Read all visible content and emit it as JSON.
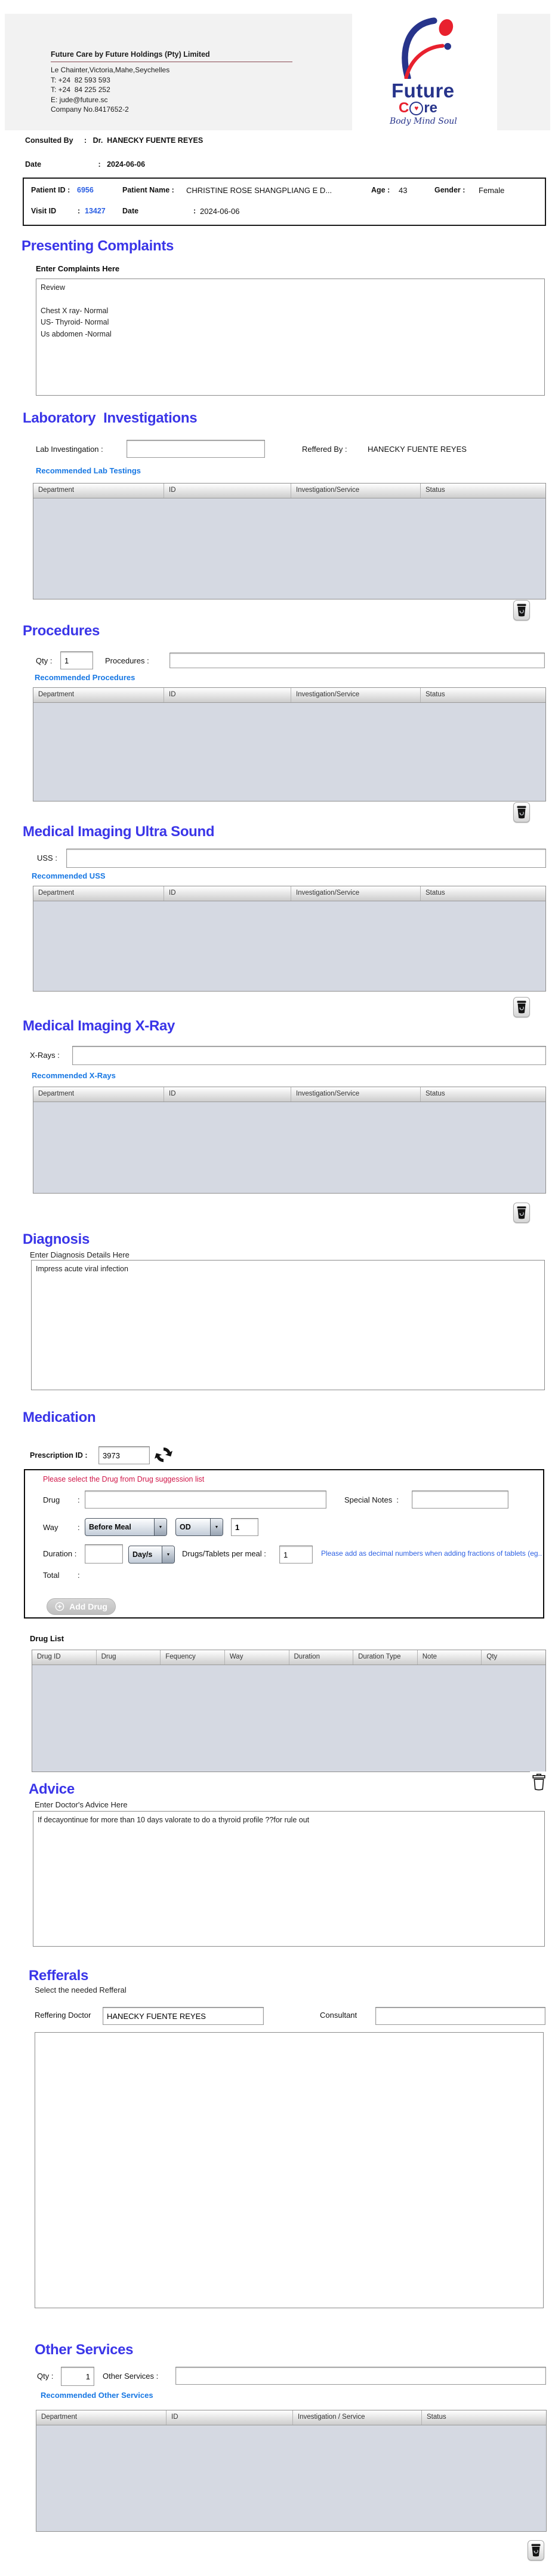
{
  "colors": {
    "section_heading": "#3a35e8",
    "link_blue": "#1777e3",
    "value_blue": "#2b5fe3",
    "note_red": "#d01648",
    "logo_navy": "#27348b",
    "logo_red": "#e8212e",
    "table_body": "#d5d9e2"
  },
  "icons": {
    "delete": "trash-icon",
    "delete_outline": "trash-outline-icon",
    "refresh": "refresh-icon",
    "add": "plus-circle-icon",
    "dropdown": "chevron-down-icon",
    "heart": "heart-icon"
  },
  "company": {
    "name": "Future Care by Future Holdings (Pty) Limited",
    "address": "Le Chainter,Victoria,Mahe,Seychelles",
    "tel1": "T: +24  82 593 593",
    "tel2": "T: +24  84 225 252",
    "email": "E: jude@future.sc",
    "company_no": "Company No.8417652-2"
  },
  "logo": {
    "future": "Future",
    "care_c": "C",
    "care_re": "re",
    "heart": "♥",
    "tagline": "Body Mind Soul"
  },
  "consult": {
    "label": "Consulted By",
    "colon": ":",
    "value": "Dr.  HANECKY FUENTE REYES",
    "date_label": "Date",
    "date_colon": ":",
    "date_value": "2024-06-06"
  },
  "patient": {
    "id_label": "Patient ID :",
    "id": "6956",
    "name_label": "Patient Name :",
    "name": "CHRISTINE ROSE SHANGPLIANG E D...",
    "age_label": "Age :",
    "age": "43",
    "gender_label": "Gender :",
    "gender": "Female",
    "visit_label": "Visit ID",
    "visit_colon": ":",
    "visit": "13427",
    "date_label": "Date",
    "date_colon": ":",
    "date": "2024-06-06"
  },
  "complaints": {
    "heading": "Presenting Complaints",
    "sub": "Enter Complaints Here",
    "text": "Review\n\nChest X ray- Normal\nUS- Thyroid- Normal\nUs abdomen -Normal"
  },
  "svc_headers": [
    "Department",
    "ID",
    "Investigation/Service",
    "Status"
  ],
  "lab": {
    "heading": "Laboratory  Investigations",
    "label": "Lab Investingation :",
    "value": "",
    "ref_label": "Reffered By :",
    "ref_value": "HANECKY FUENTE REYES",
    "link": "Recommended Lab Testings"
  },
  "procedures": {
    "heading": "Procedures",
    "qty_label": "Qty :",
    "qty": "1",
    "label": "Procedures :",
    "value": "",
    "link": "Recommended Procedures"
  },
  "uss": {
    "heading": "Medical Imaging Ultra Sound",
    "label": "USS :",
    "value": "",
    "link": "Recommended USS"
  },
  "xray": {
    "heading": "Medical Imaging X-Ray",
    "label": "X-Rays :",
    "value": "",
    "link": "Recommended X-Rays"
  },
  "diagnosis": {
    "heading": "Diagnosis",
    "sub": "Enter Diagnosis Details Here",
    "text": "Impress acute viral infection"
  },
  "medication": {
    "heading": "Medication",
    "prescription_label": "Prescription ID :",
    "prescription_id": "3973",
    "note_red": "Please select the Drug from Drug suggession list",
    "drug_label": "Drug",
    "colon": ":",
    "special_label": "Special Notes  :",
    "way_label": "Way",
    "way_meal": "Before Meal",
    "way_freq": "OD",
    "way_qty": "1",
    "duration_label": "Duration :",
    "duration_value": "",
    "duration_unit": "Day/s",
    "per_meal_label": "Drugs/Tablets per meal :",
    "per_meal_value": "1",
    "note_blue": "Please add as decimal numbers when adding fractions of tablets (eg...",
    "total_label": "Total",
    "add_drug": "Add Drug"
  },
  "drug_list": {
    "label": "Drug List",
    "headers": [
      "Drug ID",
      "Drug",
      "Fequency",
      "Way",
      "Duration",
      "Duration Type",
      "Note",
      "Qty"
    ]
  },
  "advice": {
    "heading": "Advice",
    "sub": "Enter Doctor's Advice Here",
    "text": "If decayontinue for more than 10 days valorate to do a thyroid profile ??for rule out"
  },
  "referrals": {
    "heading": "Refferals",
    "sub": "Select the needed Refferal",
    "doctor_label": "Reffering Doctor",
    "doctor": "HANECKY FUENTE REYES",
    "consultant_label": "Consultant",
    "consultant": ""
  },
  "other": {
    "heading": "Other Services",
    "qty_label": "Qty :",
    "qty": "1",
    "label": "Other Services :",
    "value": "",
    "link": "Recommended Other Services",
    "headers": [
      "Department",
      "ID",
      "Investigation / Service",
      "Status"
    ]
  }
}
